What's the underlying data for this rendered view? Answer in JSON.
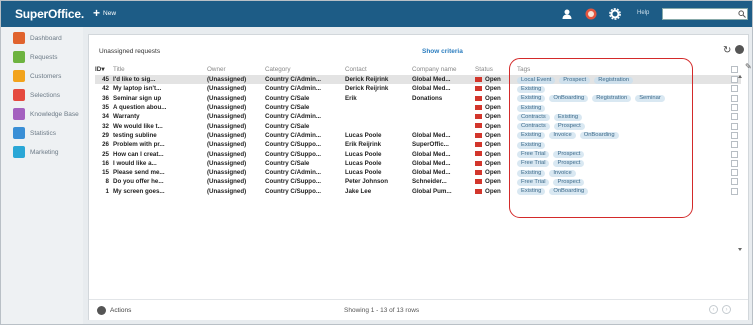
{
  "app": {
    "brand": "SuperOffice.",
    "new_label": "New",
    "help_label": "Help"
  },
  "sidebar": {
    "items": [
      {
        "label": "Dashboard",
        "icon": "dashboard-icon",
        "color": "#e0632d"
      },
      {
        "label": "Requests",
        "icon": "requests-icon",
        "color": "#6db33f"
      },
      {
        "label": "Customers",
        "icon": "customers-icon",
        "color": "#f2a31c"
      },
      {
        "label": "Selections",
        "icon": "selections-icon",
        "color": "#e54a3f"
      },
      {
        "label": "Knowledge Base",
        "icon": "knowledge-base-icon",
        "color": "#a461bf"
      },
      {
        "label": "Statistics",
        "icon": "statistics-icon",
        "color": "#3a8fd6"
      },
      {
        "label": "Marketing",
        "icon": "marketing-icon",
        "color": "#2aa7d6"
      }
    ]
  },
  "panel": {
    "title": "Unassigned requests",
    "criteria_link": "Show criteria"
  },
  "table": {
    "headers": [
      "ID",
      "Title",
      "Owner",
      "Category",
      "Contact",
      "Company name",
      "Status",
      "Tags"
    ],
    "rows": [
      {
        "id": "45",
        "title": "I'd like to sig...",
        "owner": "(Unassigned)",
        "category": "Country C/Admin...",
        "contact": "Derick Reijrink",
        "company": "Global Med...",
        "status": "Open",
        "tags": [
          "Local Event",
          "Prospect",
          "Registration"
        ],
        "selected": true
      },
      {
        "id": "42",
        "title": "My laptop isn't...",
        "owner": "(Unassigned)",
        "category": "Country C/Admin...",
        "contact": "Derick Reijrink",
        "company": "Global Med...",
        "status": "Open",
        "tags": [
          "Existing"
        ]
      },
      {
        "id": "36",
        "title": "Seminar sign up",
        "owner": "(Unassigned)",
        "category": "Country C/Sale",
        "contact": "Erik",
        "company": "Donations",
        "status": "Open",
        "tags": [
          "Existing",
          "OnBoarding",
          "Registration",
          "Seminar"
        ]
      },
      {
        "id": "35",
        "title": "A question abou...",
        "owner": "(Unassigned)",
        "category": "Country C/Sale",
        "contact": "",
        "company": "",
        "status": "Open",
        "tags": [
          "Existing"
        ]
      },
      {
        "id": "34",
        "title": "Warranty",
        "owner": "(Unassigned)",
        "category": "Country C/Admin...",
        "contact": "",
        "company": "",
        "status": "Open",
        "tags": [
          "Contracts",
          "Existing"
        ]
      },
      {
        "id": "32",
        "title": "We would like t...",
        "owner": "(Unassigned)",
        "category": "Country C/Sale",
        "contact": "",
        "company": "",
        "status": "Open",
        "tags": [
          "Contracts",
          "Prospect"
        ]
      },
      {
        "id": "29",
        "title": "testing subline",
        "owner": "(Unassigned)",
        "category": "Country C/Admin...",
        "contact": "Lucas Poole",
        "company": "Global Med...",
        "status": "Open",
        "tags": [
          "Existing",
          "Invoice",
          "OnBoarding"
        ]
      },
      {
        "id": "26",
        "title": "Problem with pr...",
        "owner": "(Unassigned)",
        "category": "Country C/Suppo...",
        "contact": "Erik Reijrink",
        "company": "SuperOffic...",
        "status": "Open",
        "tags": [
          "Existing"
        ]
      },
      {
        "id": "25",
        "title": "How can I creat...",
        "owner": "(Unassigned)",
        "category": "Country C/Suppo...",
        "contact": "Lucas Poole",
        "company": "Global Med...",
        "status": "Open",
        "tags": [
          "Free Trial",
          "Prospect"
        ]
      },
      {
        "id": "16",
        "title": "I would like a...",
        "owner": "(Unassigned)",
        "category": "Country C/Sale",
        "contact": "Lucas Poole",
        "company": "Global Med...",
        "status": "Open",
        "tags": [
          "Free Trial",
          "Prospect"
        ]
      },
      {
        "id": "15",
        "title": "Please send me...",
        "owner": "(Unassigned)",
        "category": "Country C/Admin...",
        "contact": "Lucas Poole",
        "company": "Global Med...",
        "status": "Open",
        "tags": [
          "Existing",
          "Invoice"
        ]
      },
      {
        "id": "8",
        "title": "Do you offer he...",
        "owner": "(Unassigned)",
        "category": "Country C/Suppo...",
        "contact": "Peter Johnson",
        "company": "Schneider...",
        "status": "Open",
        "tags": [
          "Free Trial",
          "Prospect"
        ]
      },
      {
        "id": "1",
        "title": "My screen goes...",
        "owner": "(Unassigned)",
        "category": "Country C/Suppo...",
        "contact": "Jake Lee",
        "company": "Global Pum...",
        "status": "Open",
        "tags": [
          "Existing",
          "OnBoarding"
        ]
      }
    ]
  },
  "footer": {
    "actions_label": "Actions",
    "row_count": "Showing 1 - 13 of 13 rows"
  },
  "colors": {
    "topbar": "#1d5c86",
    "highlight": "#d32a2a",
    "status_icon": "#d2362c",
    "tag_bg": "#d9e8f2"
  }
}
